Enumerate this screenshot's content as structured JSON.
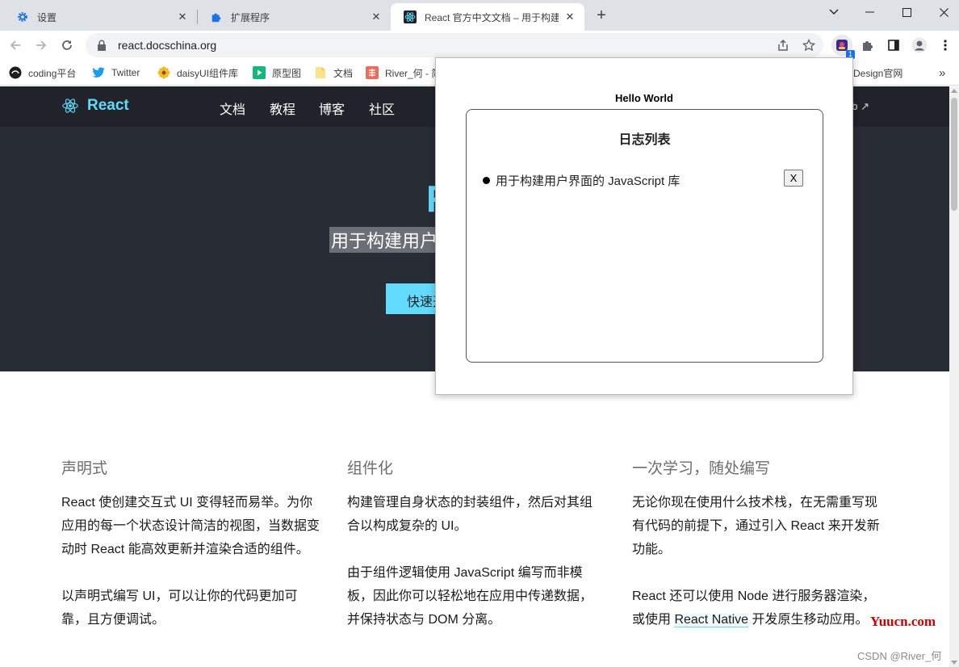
{
  "browser": {
    "tabs": [
      {
        "title": "设置",
        "icon": "gear-icon"
      },
      {
        "title": "扩展程序",
        "icon": "puzzle-icon"
      },
      {
        "title": "React 官方中文文档 – 用于构建用户界面的 JavaScript 库",
        "icon": "react-icon"
      }
    ],
    "new_tab_label": "+",
    "url": "react.docschina.org",
    "extension_badge": "1",
    "bookmarks": [
      {
        "label": "coding平台",
        "icon": "coding-icon"
      },
      {
        "label": "Twitter",
        "icon": "twitter-icon"
      },
      {
        "label": "daisyUI组件库",
        "icon": "flower-icon"
      },
      {
        "label": "原型图",
        "icon": "play-icon"
      },
      {
        "label": "文档",
        "icon": "folder-icon"
      },
      {
        "label": "River_何 - 简",
        "icon": "jianshu-icon"
      },
      {
        "label": "Design官网",
        "icon": ""
      }
    ],
    "bookmarks_overflow": "»"
  },
  "site": {
    "brand": "React",
    "nav": [
      "文档",
      "教程",
      "博客",
      "社区"
    ],
    "github": "ub",
    "hero_title": "R",
    "hero_subtitle": "用于构建用户",
    "hero_button": "快速开",
    "colors": {
      "accent": "#61dafb",
      "nav_bg": "#20232a",
      "hero_bg": "#282c34"
    },
    "features": [
      {
        "title": "声明式",
        "paragraphs": [
          "React 使创建交互式 UI 变得轻而易举。为你应用的每一个状态设计简洁的视图，当数据变动时 React 能高效更新并渲染合适的组件。",
          "以声明式编写 UI，可以让你的代码更加可靠，且方便调试。"
        ]
      },
      {
        "title": "组件化",
        "paragraphs": [
          "构建管理自身状态的封装组件，然后对其组合以构成复杂的 UI。",
          "由于组件逻辑使用 JavaScript 编写而非模板，因此你可以轻松地在应用中传递数据，并保持状态与 DOM 分离。"
        ]
      },
      {
        "title": "一次学习，随处编写",
        "paragraphs": [
          "无论你现在使用什么技术栈，在无需重写现有代码的前提下，通过引入 React 来开发新功能。"
        ],
        "p2_before": "React 还可以使用 Node 进行服务器渲染，或使用 ",
        "p2_link": "React Native",
        "p2_after": " 开发原生移动应用。"
      }
    ]
  },
  "watermarks": {
    "site": "Yuucn.com",
    "author": "CSDN @River_何"
  },
  "popup": {
    "title": "Hello World",
    "list_title": "日志列表",
    "items": [
      {
        "text": "用于构建用户界面的 JavaScript 库",
        "delete_label": "X"
      }
    ]
  }
}
